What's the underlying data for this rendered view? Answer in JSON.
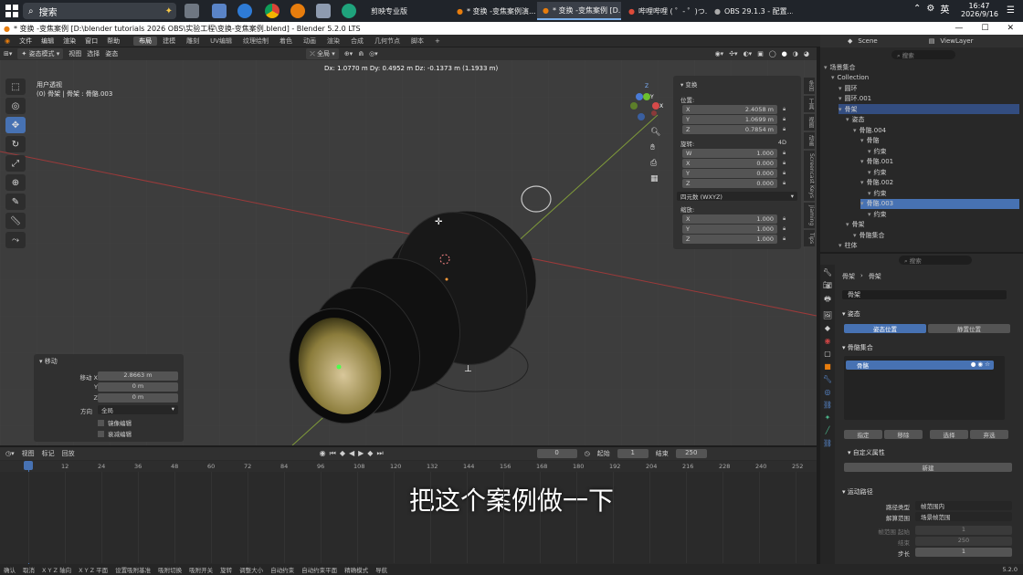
{
  "taskbar": {
    "search_label": "搜索",
    "tabs": [
      "剪映专业版",
      "* 变换 -变焦案例演...",
      "* 变换 -变焦案例 [D...",
      "哔哩哔哩 ( ゜- ゜)つ...",
      "OBS 29.1.3 - 配置..."
    ],
    "ime": "英",
    "time": "16:47",
    "date": "2026/9/16"
  },
  "titlebar": {
    "title": "* 变换 -变焦案例 [D:\\blender tutorials 2026 OBS\\实验工程\\变换-变焦案例.blend] - Blender 5.2.0 LTS"
  },
  "menu": [
    "文件",
    "编辑",
    "渲染",
    "窗口",
    "帮助"
  ],
  "workspaces": [
    "布局",
    "建模",
    "雕刻",
    "UV编辑",
    "纹理绘制",
    "着色",
    "动画",
    "渲染",
    "合成",
    "几何节点",
    "脚本",
    "+"
  ],
  "viewport_header": {
    "mode": "姿态模式",
    "items": [
      "视图",
      "选择",
      "姿态"
    ],
    "orientation": "全局"
  },
  "viewport": {
    "info_line1": "用户透视",
    "info_line2": "(0) 骨架 | 骨架 : 骨骼.003",
    "delta": "Dx: 1.0770 m   Dy: 0.4952 m   Dz: -0.1373 m (1.1933 m)"
  },
  "npanel": {
    "header": "变换",
    "location_label": "位置:",
    "location": [
      {
        "axis": "X",
        "value": "2.4058 m"
      },
      {
        "axis": "Y",
        "value": "1.0699 m"
      },
      {
        "axis": "Z",
        "value": "0.7854 m"
      }
    ],
    "rotation_label": "旋转:",
    "rotation_mode_tag": "4D",
    "rotation": [
      {
        "axis": "W",
        "value": "1.000"
      },
      {
        "axis": "X",
        "value": "0.000"
      },
      {
        "axis": "Y",
        "value": "0.000"
      },
      {
        "axis": "Z",
        "value": "0.000"
      }
    ],
    "rotation_mode": "四元数 (WXYZ)",
    "scale_label": "缩放:",
    "scale": [
      {
        "axis": "X",
        "value": "1.000"
      },
      {
        "axis": "Y",
        "value": "1.000"
      },
      {
        "axis": "Z",
        "value": "1.000"
      }
    ]
  },
  "side_tabs": [
    "条目",
    "工具",
    "视图",
    "动画",
    "Screencast Keys",
    "Jiaming",
    "Tips"
  ],
  "operator_panel": {
    "title": "移动",
    "rows": [
      {
        "label": "移动 X",
        "value": "2.8663 m"
      },
      {
        "label": "Y",
        "value": "0 m"
      },
      {
        "label": "Z",
        "value": "0 m"
      }
    ],
    "orient_label": "方向",
    "orient_value": "全局",
    "check1": "镜像编辑",
    "check2": "衰减编辑"
  },
  "timeline": {
    "menus": [
      "视图",
      "标记",
      "回放"
    ],
    "current_frame": "0",
    "start_label": "起始",
    "start": "1",
    "end_label": "结束",
    "end": "250",
    "ticks": [
      "0",
      "12",
      "24",
      "36",
      "48",
      "60",
      "72",
      "84",
      "96",
      "108",
      "120",
      "132",
      "144",
      "156",
      "168",
      "180",
      "192",
      "204",
      "216",
      "228",
      "240",
      "252"
    ]
  },
  "subtitle": "把这个案例做一下",
  "statusbar": [
    "确认",
    "取消",
    "X Y Z 轴向",
    "X Y Z 平面",
    "设置吸附基准",
    "吸附切换",
    "吸附开关",
    "旋转",
    "调整大小",
    "自动约束",
    "自动约束平面",
    "精确模式",
    "导航"
  ],
  "version": "5.2.0",
  "outliner_header": {
    "scene": "Scene",
    "viewlayer": "ViewLayer",
    "search": "搜索"
  },
  "outliner": [
    {
      "label": "场景集合",
      "indent": 0
    },
    {
      "label": "Collection",
      "indent": 1
    },
    {
      "label": "圆环",
      "indent": 2
    },
    {
      "label": "圆环.001",
      "indent": 2
    },
    {
      "label": "骨架",
      "indent": 2,
      "sel": true
    },
    {
      "label": "姿态",
      "indent": 3
    },
    {
      "label": "骨骼.004",
      "indent": 4
    },
    {
      "label": "骨骼",
      "indent": 5
    },
    {
      "label": "约束",
      "indent": 6
    },
    {
      "label": "骨骼.001",
      "indent": 5
    },
    {
      "label": "约束",
      "indent": 6
    },
    {
      "label": "骨骼.002",
      "indent": 5
    },
    {
      "label": "约束",
      "indent": 6
    },
    {
      "label": "骨骼.003",
      "indent": 5,
      "active": true
    },
    {
      "label": "约束",
      "indent": 6
    },
    {
      "label": "骨架",
      "indent": 3
    },
    {
      "label": "骨骼集合",
      "indent": 4
    },
    {
      "label": "柱体",
      "indent": 2
    }
  ],
  "props": {
    "search": "搜索",
    "breadcrumb1": "骨架",
    "breadcrumb2": "骨架",
    "datablock": "骨架",
    "pose_section": "姿态",
    "pose_btn1": "姿态位置",
    "pose_btn2": "静置位置",
    "bonecoll_section": "骨骼集合",
    "bonecoll_item": "骨骼",
    "assign": "指定",
    "remove": "移除",
    "select": "选择",
    "deselect": "弃选",
    "custom_section": "自定义属性",
    "new_btn": "新建",
    "motion_section": "运动路径",
    "path_type_label": "路径类型",
    "path_type": "帧范围内",
    "calc_range_label": "解算范围",
    "calc_range": "场景帧范围",
    "frame_start_label": "帧范围 起始",
    "frame_start": "1",
    "frame_end_label": "结束",
    "frame_end": "250",
    "step_label": "步长",
    "step": "1"
  }
}
